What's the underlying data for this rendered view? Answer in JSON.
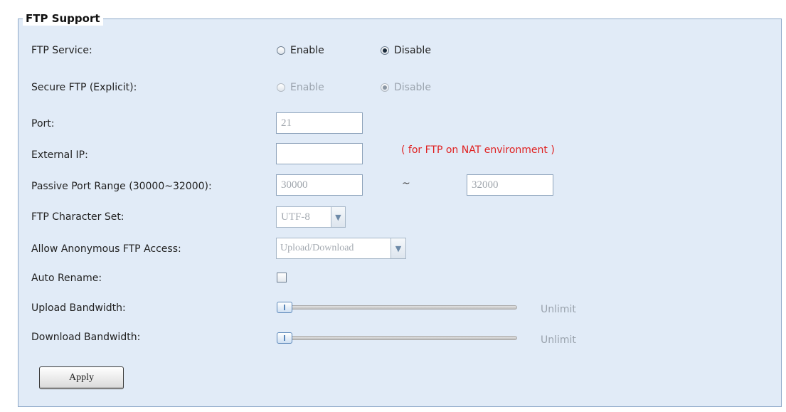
{
  "section": {
    "legend": "FTP Support"
  },
  "ftp_service": {
    "label": "FTP Service:",
    "enable": "Enable",
    "disable": "Disable",
    "selected": "Disable"
  },
  "secure_ftp": {
    "label": "Secure FTP (Explicit):",
    "enable": "Enable",
    "disable": "Disable",
    "selected": "Disable",
    "disabled": true
  },
  "port": {
    "label": "Port:",
    "value": "21"
  },
  "external_ip": {
    "label": "External IP:",
    "value": "",
    "note": "( for FTP on NAT environment )"
  },
  "passive_range": {
    "label": "Passive Port Range (30000~32000):",
    "from": "30000",
    "separator": "~",
    "to": "32000"
  },
  "charset": {
    "label": "FTP Character Set:",
    "value": "UTF-8"
  },
  "anonymous": {
    "label": "Allow Anonymous FTP Access:",
    "value": "Upload/Download"
  },
  "auto_rename": {
    "label": "Auto Rename:",
    "checked": false
  },
  "upload_bw": {
    "label": "Upload Bandwidth:",
    "value_text": "Unlimit",
    "level": 0
  },
  "download_bw": {
    "label": "Download Bandwidth:",
    "value_text": "Unlimit",
    "level": 0
  },
  "apply_label": "Apply",
  "colors": {
    "panel_bg": "#e1ebf7",
    "note_red": "#e02020"
  }
}
